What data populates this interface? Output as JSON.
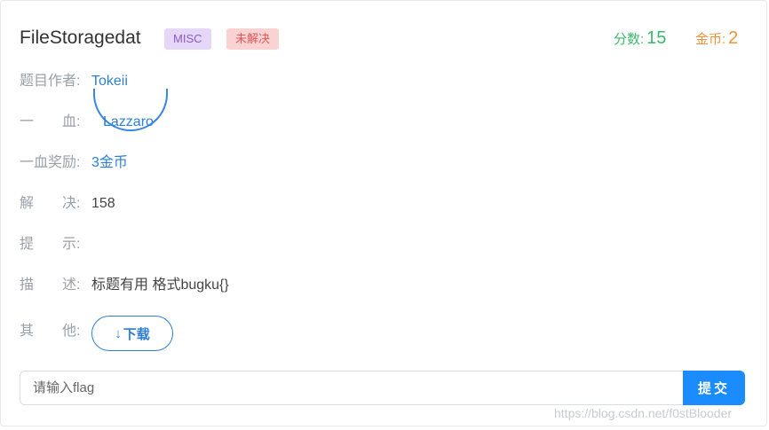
{
  "challenge": {
    "title": "FileStoragedat",
    "category_tag": "MISC",
    "status_tag": "未解决",
    "points_label": "分数:",
    "points_value": "15",
    "coins_label": "金币:",
    "coins_value": "2"
  },
  "details": {
    "author_label": "题目作者:",
    "author_value": "Tokeii",
    "first_blood_label": "一　　血:",
    "first_blood_value": "Lazzaro",
    "first_blood_reward_label": "一血奖励:",
    "first_blood_reward_value": "3金币",
    "solves_label": "解　　决:",
    "solves_value": "158",
    "hint_label": "提　　示:",
    "hint_value": "",
    "description_label": "描　　述:",
    "description_value": "标题有用 格式bugku{}",
    "other_label": "其　　他:"
  },
  "download": {
    "arrow": "↓",
    "label": "下载"
  },
  "flag_form": {
    "placeholder": "请输入flag",
    "value": "",
    "submit_label": "提交"
  },
  "watermark": "https://blog.csdn.net/f0stBlooder",
  "colors": {
    "link": "#2f7fd6",
    "points": "#3cb96a",
    "coins": "#f0913a",
    "submit": "#1a8cff",
    "misc_tag_bg": "#e6d6f7",
    "status_tag_bg": "#f9d2d2"
  }
}
